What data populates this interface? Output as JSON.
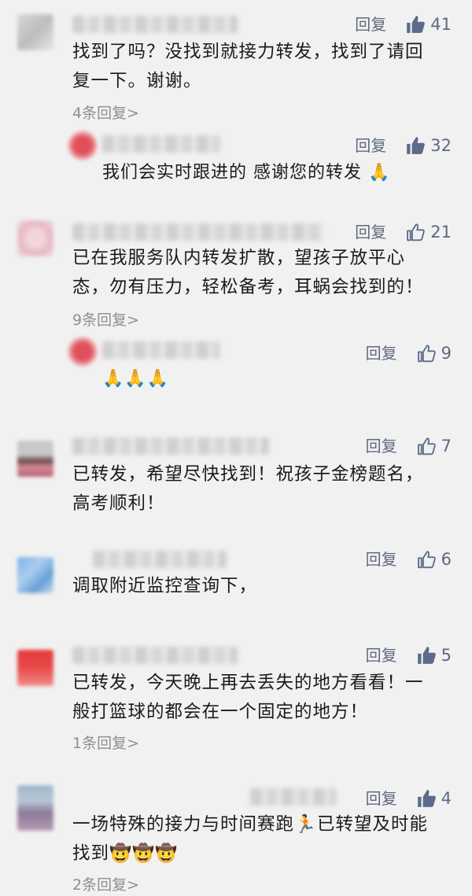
{
  "reply_label": "回复",
  "comments": [
    {
      "likes": "41",
      "liked": true,
      "text_lines": [
        "找到了吗？没找到就接力转发，找到了请回",
        "复一下。谢谢。"
      ],
      "more": "4条回复",
      "reply": {
        "likes": "32",
        "liked": true,
        "text": "我们会实时跟进的 感谢您的转发 🙏"
      }
    },
    {
      "likes": "21",
      "liked": false,
      "text_lines": [
        "已在我服务队内转发扩散，望孩子放平心",
        "态，勿有压力，轻松备考，耳蜗会找到的！"
      ],
      "more": "9条回复",
      "reply": {
        "likes": "9",
        "liked": false,
        "text": "🙏🙏🙏"
      }
    },
    {
      "likes": "7",
      "liked": false,
      "text_lines": [
        "已转发，希望尽快找到！祝孩子金榜题名，",
        "高考顺利！"
      ]
    },
    {
      "likes": "6",
      "liked": false,
      "text_lines": [
        "调取附近监控查询下，"
      ]
    },
    {
      "likes": "5",
      "liked": true,
      "text_lines": [
        "已转发，今天晚上再去丢失的地方看看！一",
        "般打篮球的都会在一个固定的地方！"
      ],
      "more": "1条回复"
    },
    {
      "likes": "4",
      "liked": true,
      "text_lines": [
        "一场特殊的接力与时间赛跑🏃已转望及时能",
        "找到🤠🤠🤠"
      ],
      "more": "2条回复"
    }
  ]
}
